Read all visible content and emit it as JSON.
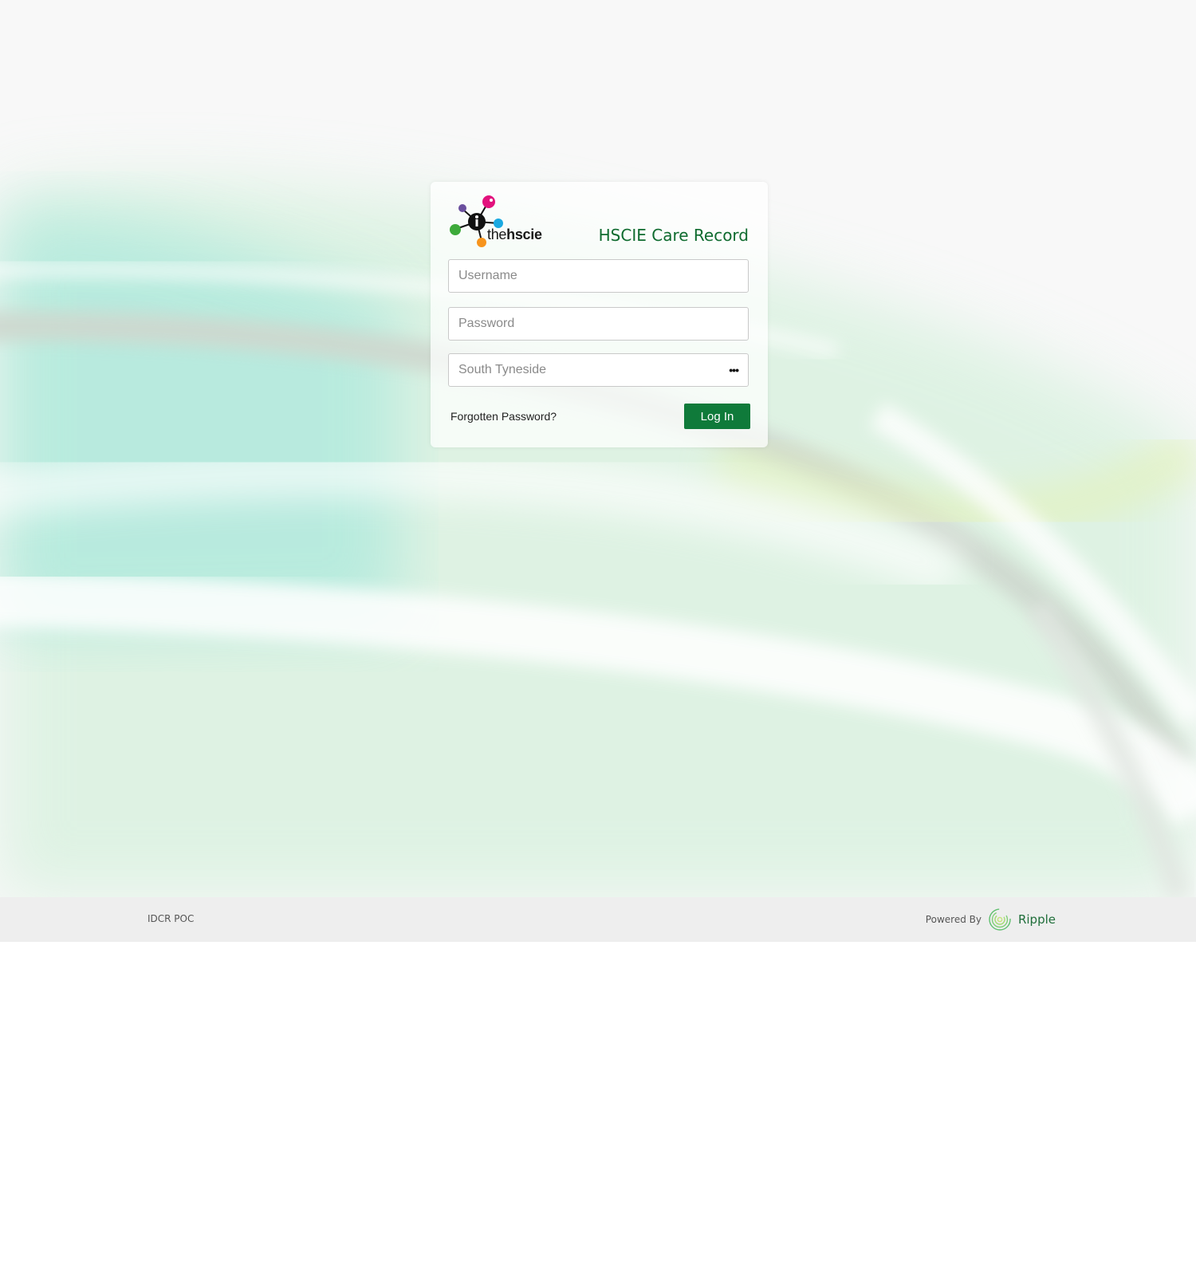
{
  "logo": {
    "prefix": "the",
    "brand": "hscie"
  },
  "header": {
    "title": "HSCIE Care Record"
  },
  "form": {
    "username_placeholder": "Username",
    "password_placeholder": "Password",
    "site_value": "South Tyneside",
    "site_icon": "ellipsis-icon",
    "forgot_label": "Forgotten Password?",
    "login_label": "Log In"
  },
  "footer": {
    "left_text": "IDCR POC",
    "powered_label": "Powered By",
    "ripple_label": "Ripple"
  },
  "colors": {
    "accent": "#0f7a3a",
    "title": "#0f6b2f",
    "footer_bg": "#eeeeee"
  }
}
